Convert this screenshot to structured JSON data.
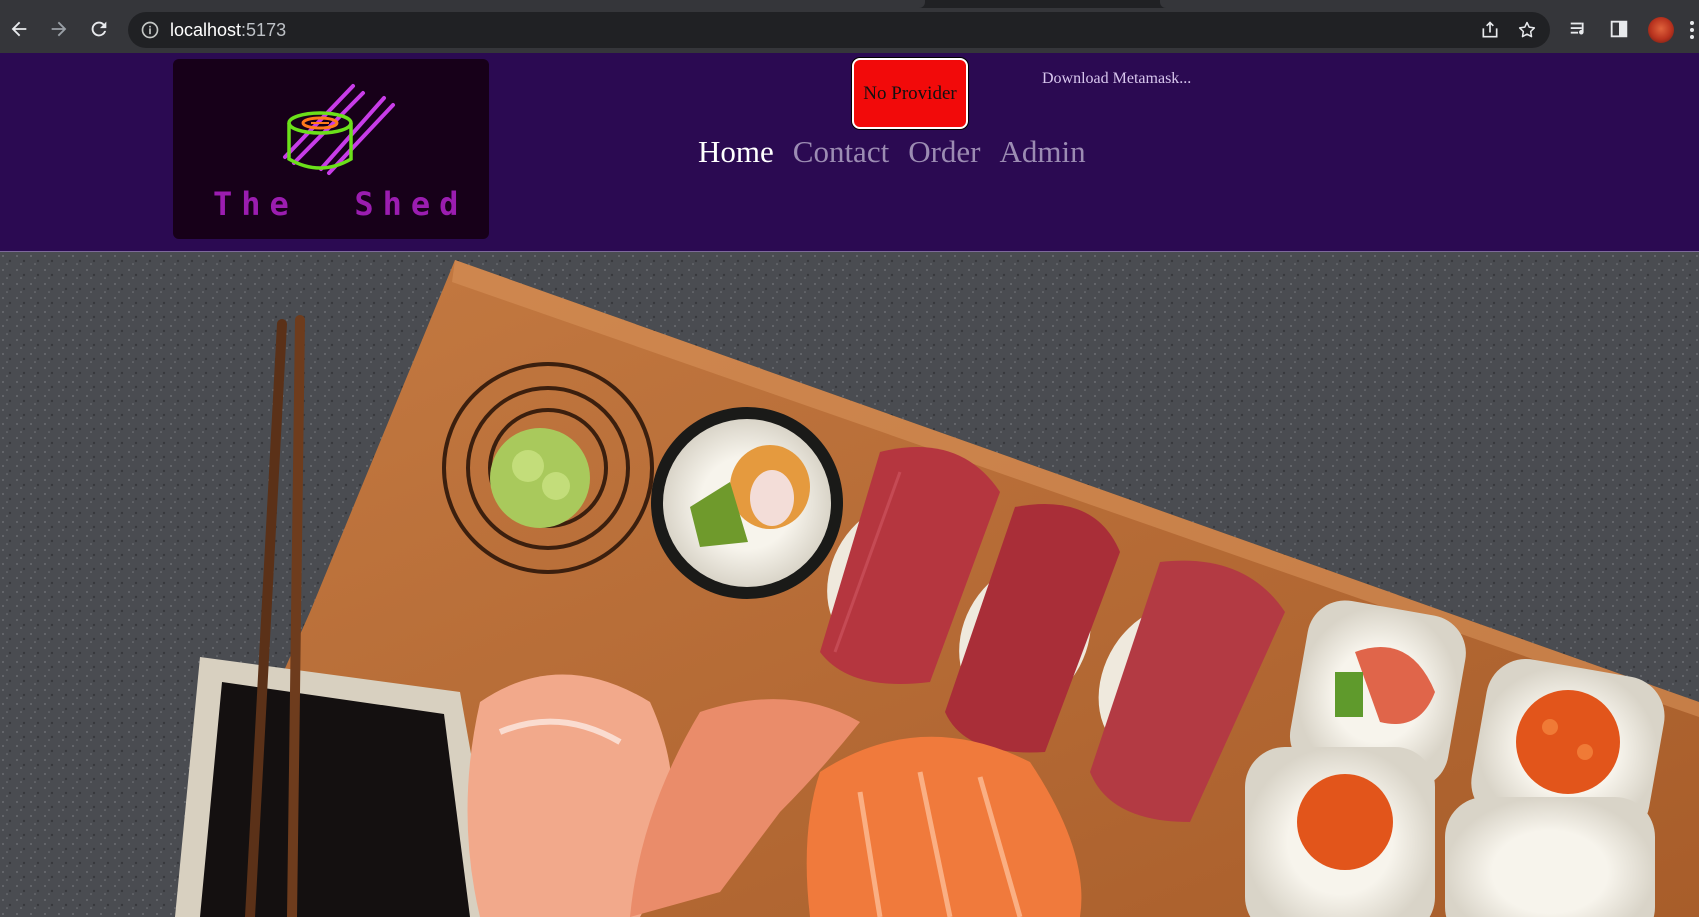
{
  "browser": {
    "url_host": "localhost",
    "url_port": ":5173",
    "back_icon": "arrow-left-icon",
    "forward_icon": "arrow-right-icon",
    "reload_icon": "reload-icon",
    "info_icon": "info-icon",
    "share_icon": "share-icon",
    "bookmark_icon": "star-icon",
    "media_icon": "media-queue-icon",
    "sidepanel_icon": "side-panel-icon",
    "menu_icon": "kebab-menu-icon"
  },
  "header": {
    "logo_text": "The  Shed",
    "provider_button": "No Provider",
    "download_link": "Download Metamask...",
    "nav": [
      {
        "label": "Home",
        "active": true
      },
      {
        "label": "Contact",
        "active": false
      },
      {
        "label": "Order",
        "active": false
      },
      {
        "label": "Admin",
        "active": false
      }
    ]
  },
  "colors": {
    "header_bg": "#2b0a52",
    "logo_bg": "#170019",
    "provider_button_bg": "#f20a0a",
    "nav_active": "#ffffff",
    "nav_inactive": "#9c8cb3",
    "logo_text": "#9b1db0",
    "logo_neon_green": "#6be01a",
    "logo_neon_pink": "#c83ce8"
  },
  "hero": {
    "image": "sushi-platter-photo"
  }
}
